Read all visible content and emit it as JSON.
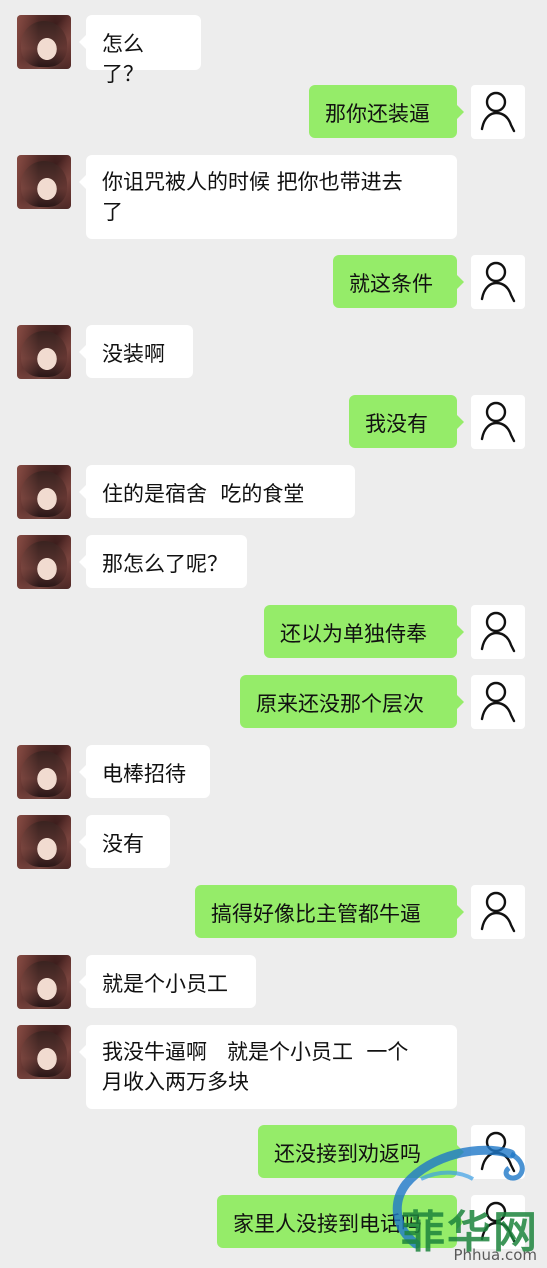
{
  "chat": {
    "messages": [
      {
        "side": "left",
        "text": "怎么了？"
      },
      {
        "side": "right",
        "text": "那你还装逼"
      },
      {
        "side": "left",
        "text": "你诅咒被人的时候 把你也带进去\n了"
      },
      {
        "side": "right",
        "text": "就这条件"
      },
      {
        "side": "left",
        "text": "没装啊"
      },
      {
        "side": "right",
        "text": "我没有"
      },
      {
        "side": "left",
        "text": "住的是宿舍  吃的食堂"
      },
      {
        "side": "left",
        "text": "那怎么了呢？"
      },
      {
        "side": "right",
        "text": "还以为单独侍奉"
      },
      {
        "side": "right",
        "text": "原来还没那个层次"
      },
      {
        "side": "left",
        "text": "电棒招待"
      },
      {
        "side": "left",
        "text": "没有"
      },
      {
        "side": "right",
        "text": "搞得好像比主管都牛逼"
      },
      {
        "side": "left",
        "text": "就是个小员工"
      },
      {
        "side": "left",
        "text": "我没牛逼啊   就是个小员工  一个\n月收入两万多块"
      },
      {
        "side": "right",
        "text": "还没接到劝返吗"
      },
      {
        "side": "right",
        "text": "家里人没接到电话吗"
      }
    ],
    "avatars": {
      "left_icon": "user-photo-avatar",
      "right_icon": "person-outline-icon"
    }
  },
  "watermark": {
    "logo_text": "菲华网",
    "url": "Phhua.com"
  },
  "colors": {
    "background": "#ededed",
    "incoming_bubble": "#ffffff",
    "outgoing_bubble": "#95ec69"
  }
}
